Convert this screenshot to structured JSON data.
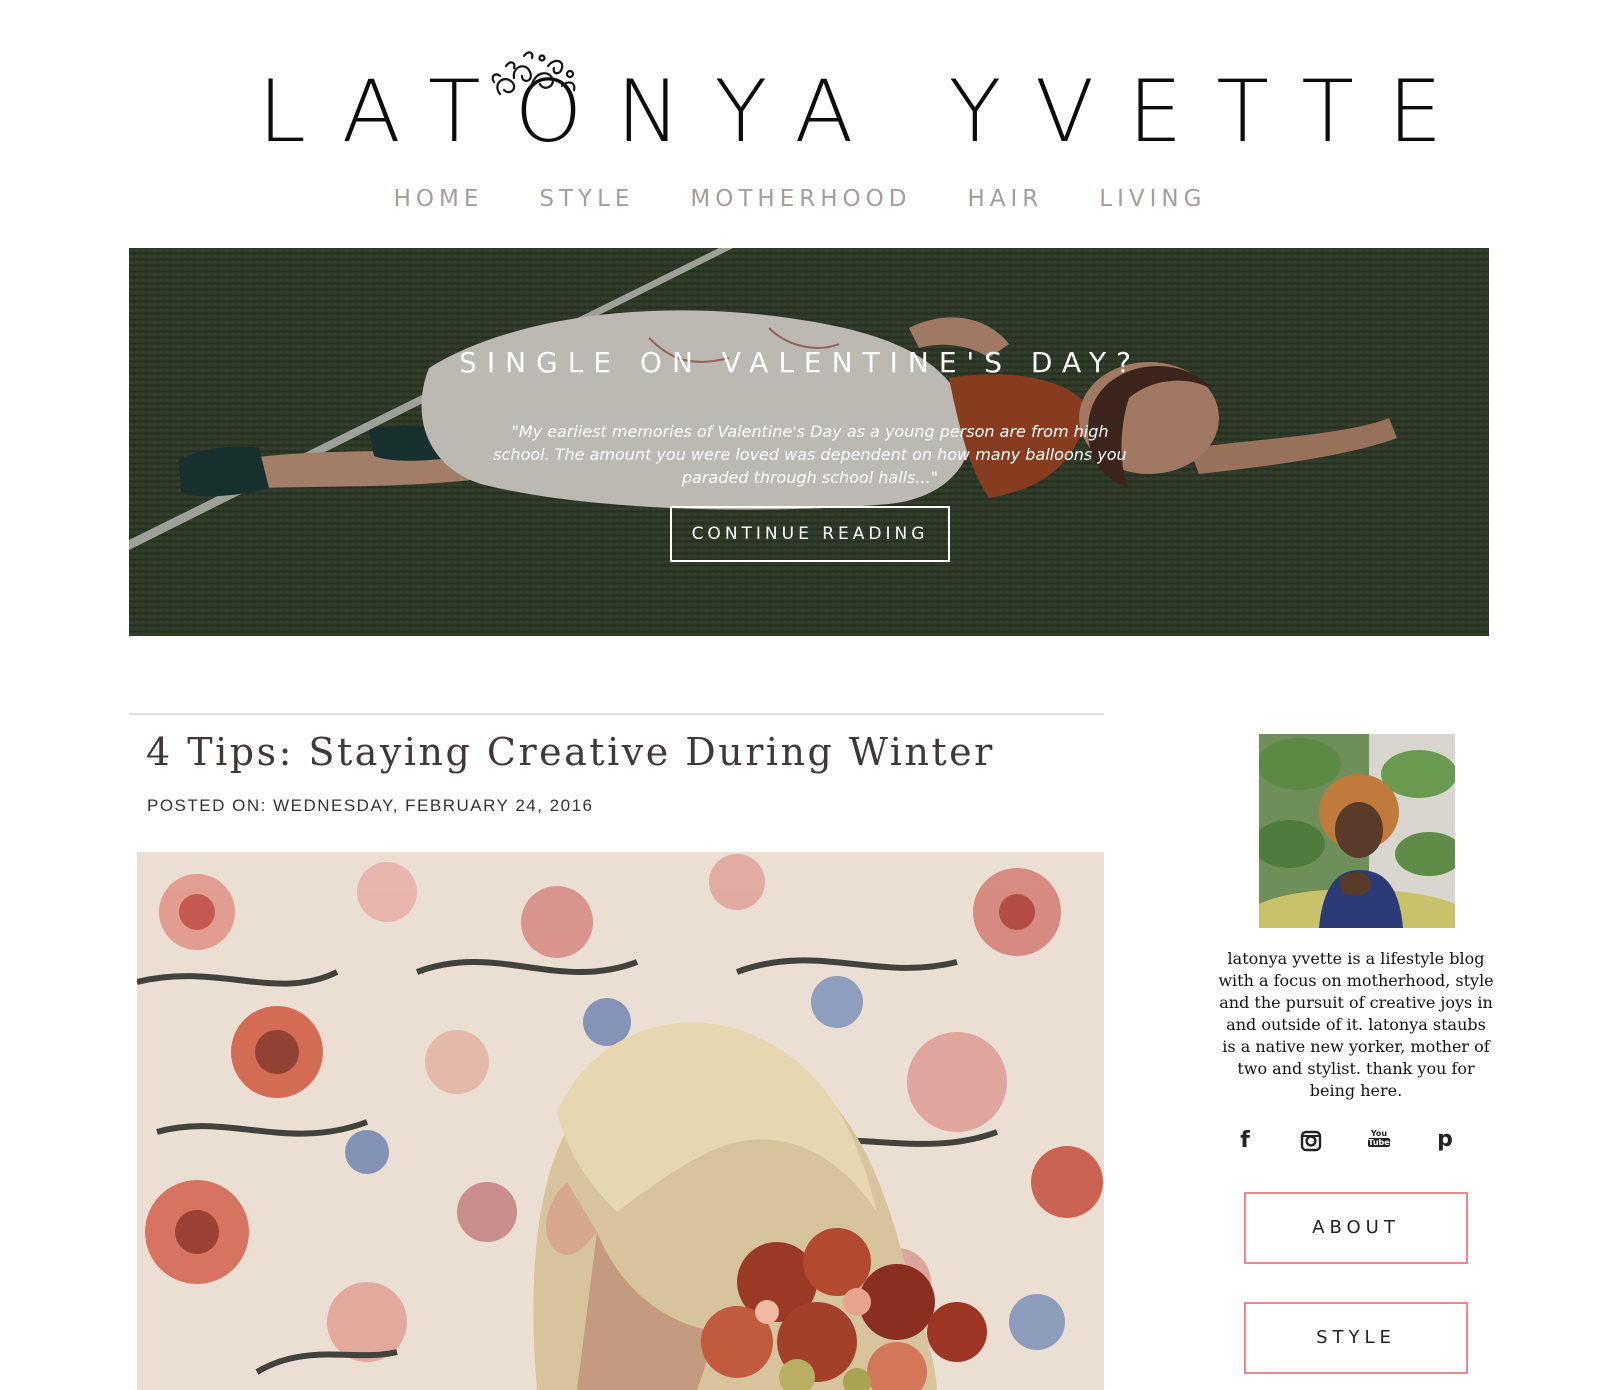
{
  "site": {
    "logo_text": "LATONYA YVETTE"
  },
  "nav": {
    "items": [
      "HOME",
      "STYLE",
      "MOTHERHOOD",
      "HAIR",
      "LIVING"
    ]
  },
  "hero": {
    "title": "SINGLE ON VALENTINE'S DAY?",
    "quote": "\"My earliest memories of Valentine's Day as a young person are from high school. The amount you were loved was dependent on how many balloons you paraded through school halls...\"",
    "button_label": "CONTINUE READING"
  },
  "post": {
    "title": "4 Tips: Staying Creative During Winter",
    "meta": "POSTED ON: WEDNESDAY, FEBRUARY 24, 2016"
  },
  "sidebar": {
    "bio": "latonya yvette is a lifestyle blog with a focus on motherhood, style and the pursuit of creative joys in and outside of it. latonya staubs is a native new yorker, mother of two and stylist. thank you for being here.",
    "social": {
      "facebook": "f",
      "youtube_top": "You",
      "youtube_bottom": "Tube",
      "pinterest": "p"
    },
    "buttons": [
      "ABOUT",
      "STYLE"
    ]
  },
  "colors": {
    "nav_text": "#a89c97",
    "button_border": "#f0868c",
    "title_text": "#3f3836"
  }
}
